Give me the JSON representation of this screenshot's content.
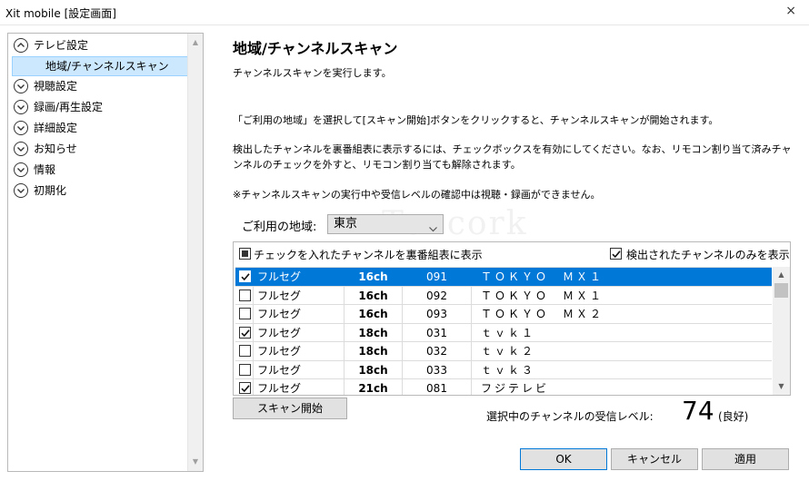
{
  "window": {
    "title": "Xit mobile [設定画面]",
    "close_glyph": "×"
  },
  "sidebar": {
    "items": [
      {
        "label": "テレビ設定",
        "expanded": true,
        "children": [
          {
            "label": "地域/チャンネルスキャン",
            "selected": true
          }
        ]
      },
      {
        "label": "視聴設定"
      },
      {
        "label": "録画/再生設定"
      },
      {
        "label": "詳細設定"
      },
      {
        "label": "お知らせ"
      },
      {
        "label": "情報"
      },
      {
        "label": "初期化"
      }
    ]
  },
  "main": {
    "title": "地域/チャンネルスキャン",
    "paragraphs": [
      "チャンネルスキャンを実行します。",
      "「ご利用の地域」を選択して[スキャン開始]ボタンをクリックすると、チャンネルスキャンが開始されます。",
      "検出したチャンネルを裏番組表に表示するには、チェックボックスを有効にしてください。なお、リモコン割り当て済みチャンネルのチェックを外すと、リモコン割り当ても解除されます。",
      "※チャンネルスキャンの実行中や受信レベルの確認中は視聴・録画ができません。"
    ],
    "region": {
      "label": "ご利用の地域:",
      "value": "東京"
    },
    "list_header": {
      "left_label": "チェックを入れたチャンネルを裏番組表に表示",
      "right_label": "検出されたチャンネルのみを表示",
      "right_checked": true
    },
    "channels": [
      {
        "checked": true,
        "type": "フルセグ",
        "ch": "16ch",
        "service": "091",
        "name": "ＴＯＫＹＯ　ＭＸ１",
        "selected": true
      },
      {
        "checked": false,
        "type": "フルセグ",
        "ch": "16ch",
        "service": "092",
        "name": "ＴＯＫＹＯ　ＭＸ１"
      },
      {
        "checked": false,
        "type": "フルセグ",
        "ch": "16ch",
        "service": "093",
        "name": "ＴＯＫＹＯ　ＭＸ２"
      },
      {
        "checked": true,
        "type": "フルセグ",
        "ch": "18ch",
        "service": "031",
        "name": "ｔｖｋ１"
      },
      {
        "checked": false,
        "type": "フルセグ",
        "ch": "18ch",
        "service": "032",
        "name": "ｔｖｋ２"
      },
      {
        "checked": false,
        "type": "フルセグ",
        "ch": "18ch",
        "service": "033",
        "name": "ｔｖｋ３"
      },
      {
        "checked": true,
        "type": "フルセグ",
        "ch": "21ch",
        "service": "081",
        "name": "フジテレビ"
      }
    ],
    "scan_button": "スキャン開始",
    "signal": {
      "label": "選択中のチャンネルの受信レベル:",
      "value": "74",
      "status": "(良好)"
    }
  },
  "footer": {
    "ok": "OK",
    "cancel": "キャンセル",
    "apply": "適用"
  },
  "watermark": "Tencork",
  "colors": {
    "selection": "#0078d7",
    "tree_selection": "#cce8ff",
    "button_face": "#e1e1e1"
  }
}
